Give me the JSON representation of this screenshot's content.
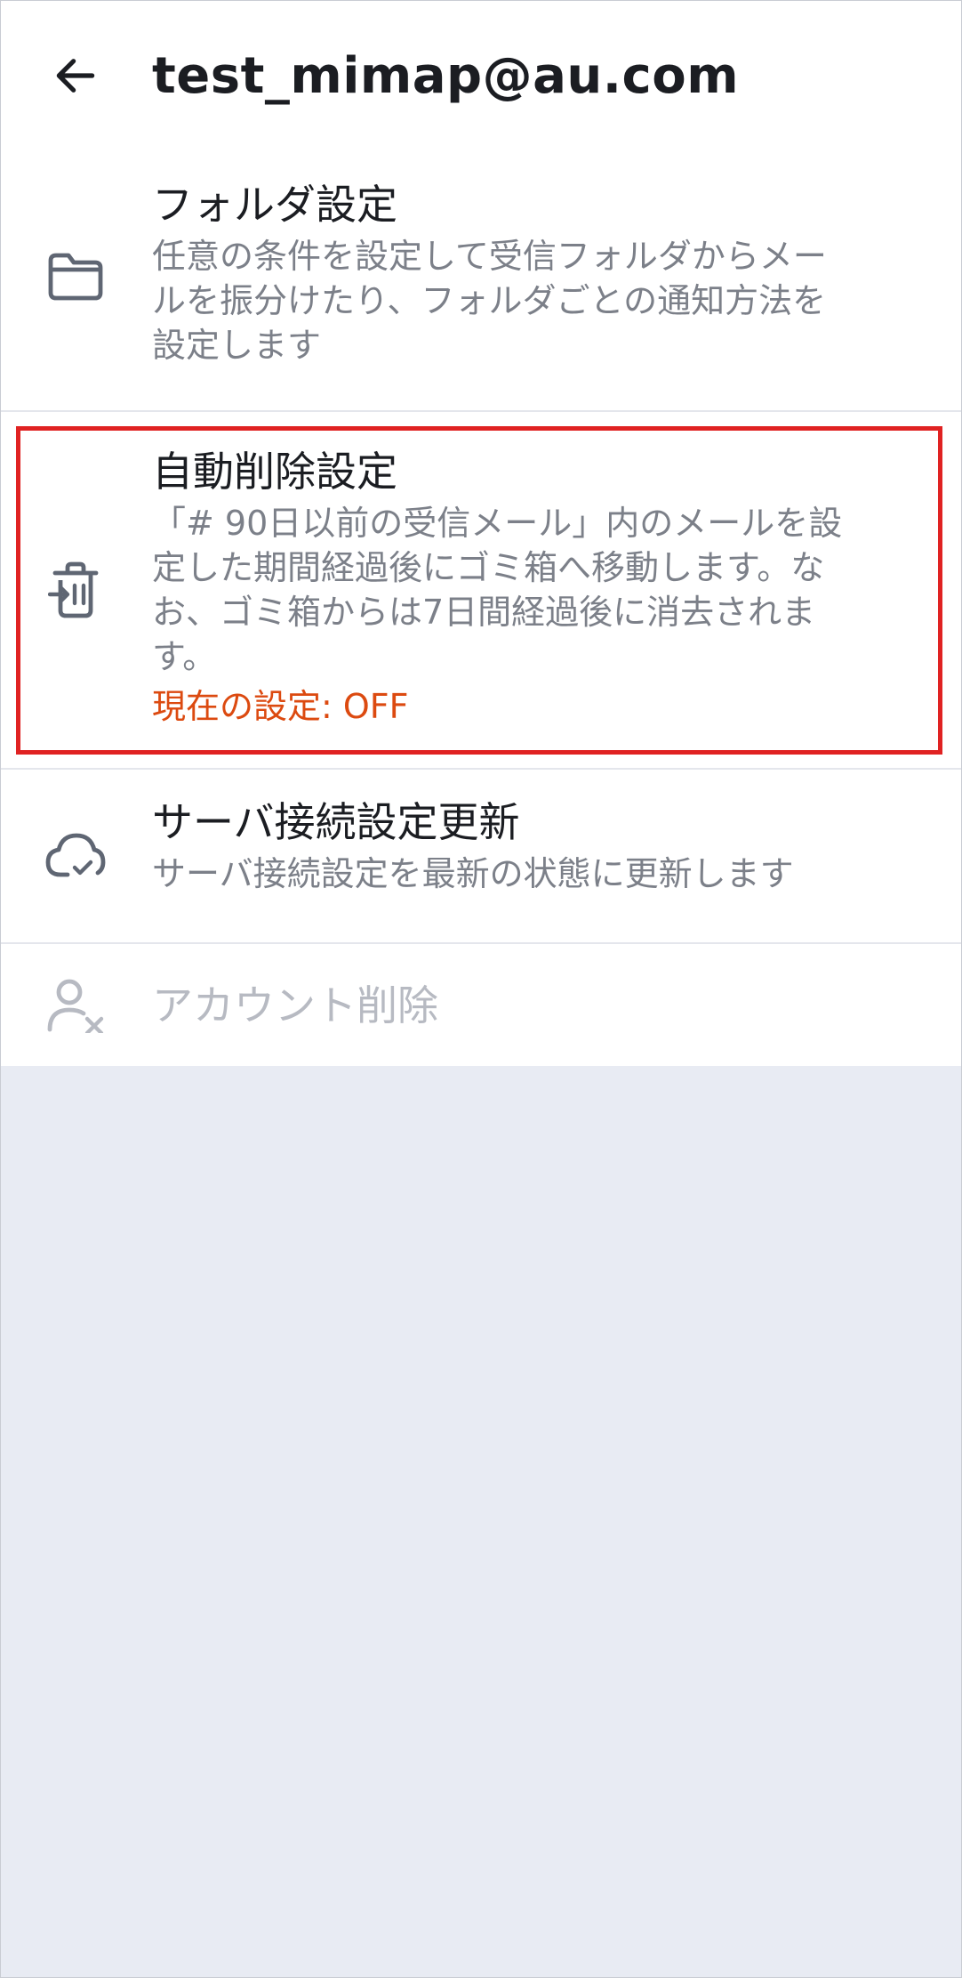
{
  "header": {
    "title": "test_mimap@au.com",
    "back_icon": "arrow-left-icon"
  },
  "items": [
    {
      "icon": "folder-icon",
      "title": "フォルダ設定",
      "desc_lines": [
        "任意の条件を設定して受信フォルダからメー",
        "ルを振分けたり、フォルダごとの通知方法を",
        "設定します"
      ]
    },
    {
      "icon": "trash-move-icon",
      "title": "自動削除設定",
      "desc_lines": [
        "「# 90日以前の受信メール」内のメールを設",
        "定した期間経過後にゴミ箱へ移動します。な",
        "お、ゴミ箱からは7日間経過後に消去されま",
        "す。"
      ],
      "status": "現在の設定: OFF"
    },
    {
      "icon": "cloud-check-icon",
      "title": "サーバ接続設定更新",
      "desc_lines": [
        "サーバ接続設定を最新の状態に更新します"
      ]
    },
    {
      "icon": "user-remove-icon",
      "title": "アカウント削除",
      "disabled": true
    }
  ],
  "colors": {
    "status": "#dc4a10",
    "highlight": "#e02222",
    "background": "#e8ebf3"
  }
}
